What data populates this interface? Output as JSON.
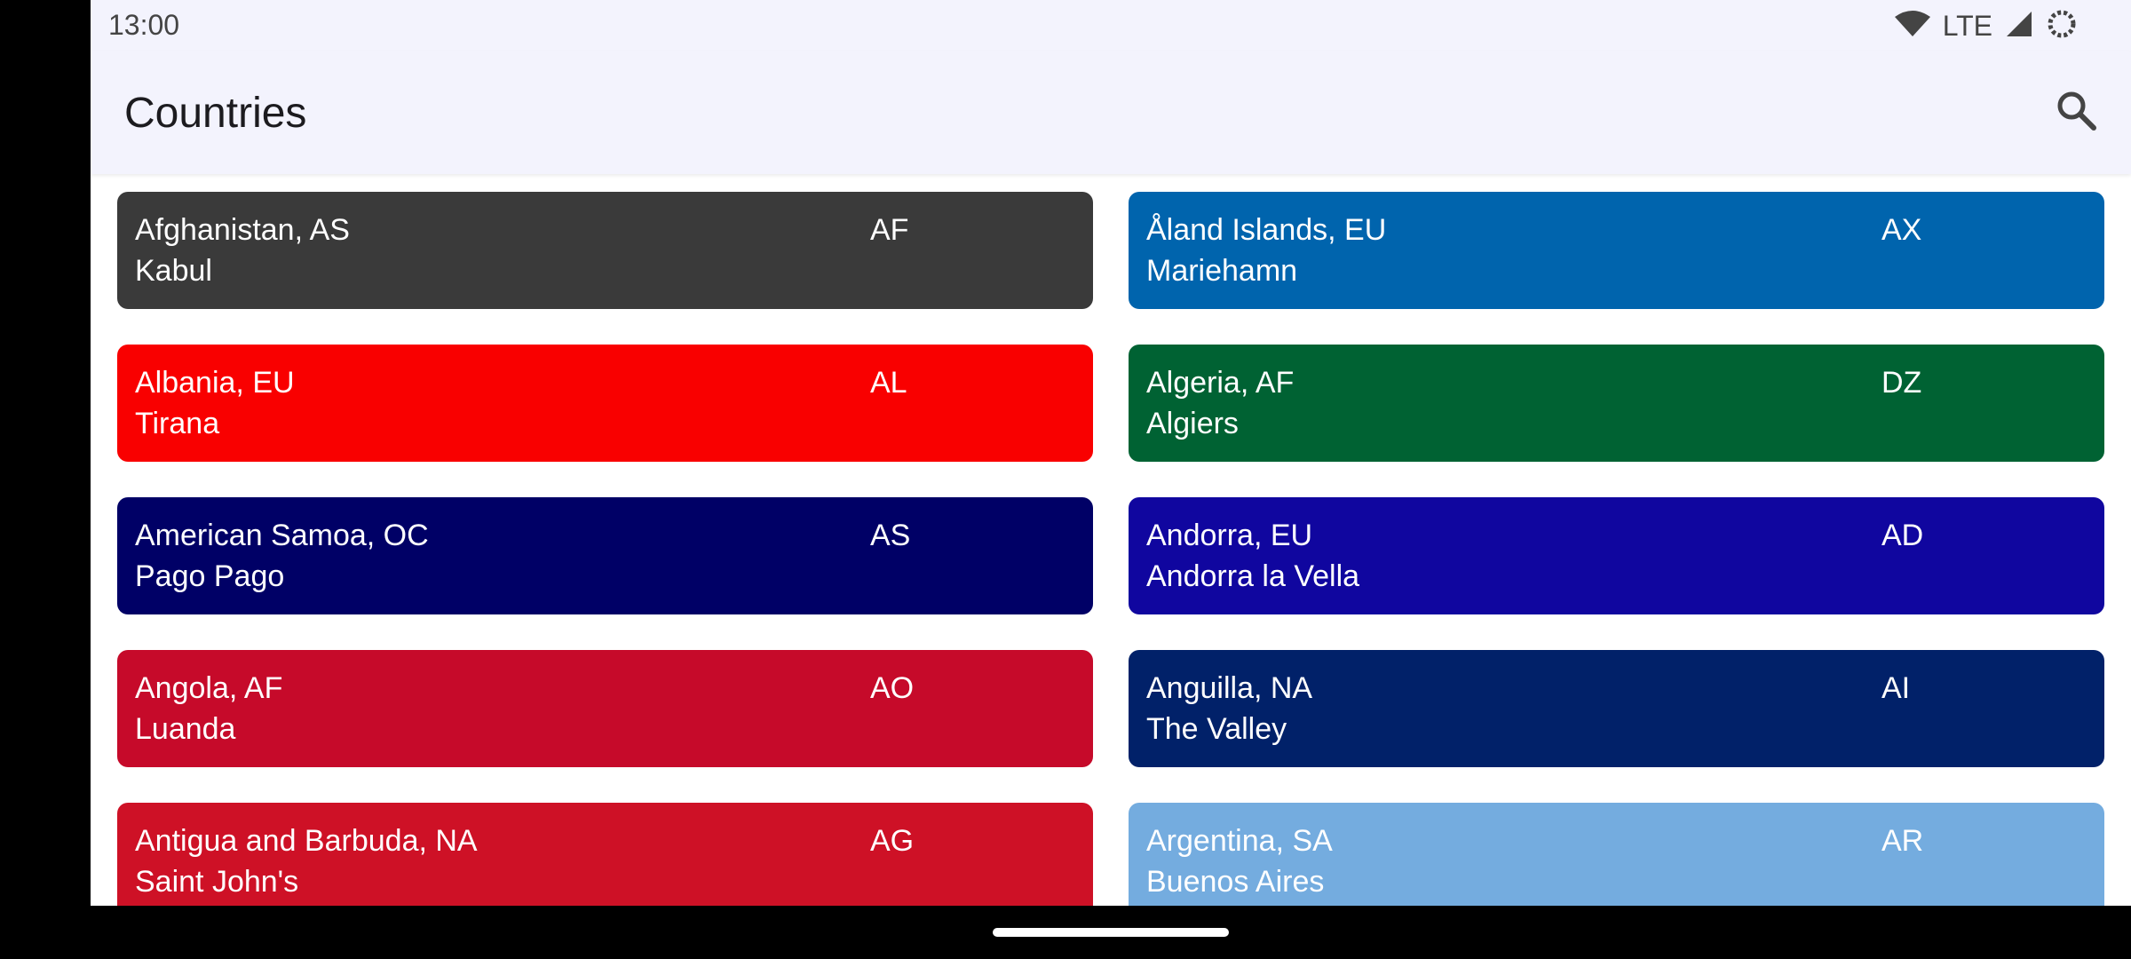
{
  "status_bar": {
    "time": "13:00",
    "network": "LTE",
    "icons": [
      "wifi-icon",
      "signal-icon",
      "sync-icon"
    ]
  },
  "app_bar": {
    "title": "Countries",
    "search_icon": "search-icon"
  },
  "countries": [
    {
      "name": "Afghanistan, AS",
      "capital": "Kabul",
      "code": "AF",
      "color": "#3a3a3a"
    },
    {
      "name": "Åland Islands, EU",
      "capital": "Mariehamn",
      "code": "AX",
      "color": "#0064ad"
    },
    {
      "name": "Albania, EU",
      "capital": "Tirana",
      "code": "AL",
      "color": "#f90000"
    },
    {
      "name": "Algeria, AF",
      "capital": "Algiers",
      "code": "DZ",
      "color": "#006233"
    },
    {
      "name": "American Samoa, OC",
      "capital": "Pago Pago",
      "code": "AS",
      "color": "#000066"
    },
    {
      "name": "Andorra, EU",
      "capital": "Andorra la Vella",
      "code": "AD",
      "color": "#10069f"
    },
    {
      "name": "Angola, AF",
      "capital": "Luanda",
      "code": "AO",
      "color": "#c60a2a"
    },
    {
      "name": "Anguilla, NA",
      "capital": "The Valley",
      "code": "AI",
      "color": "#012169"
    },
    {
      "name": "Antigua and Barbuda, NA",
      "capital": "Saint John's",
      "code": "AG",
      "color": "#ce1126"
    },
    {
      "name": "Argentina, SA",
      "capital": "Buenos Aires",
      "code": "AR",
      "color": "#74acdf"
    }
  ]
}
